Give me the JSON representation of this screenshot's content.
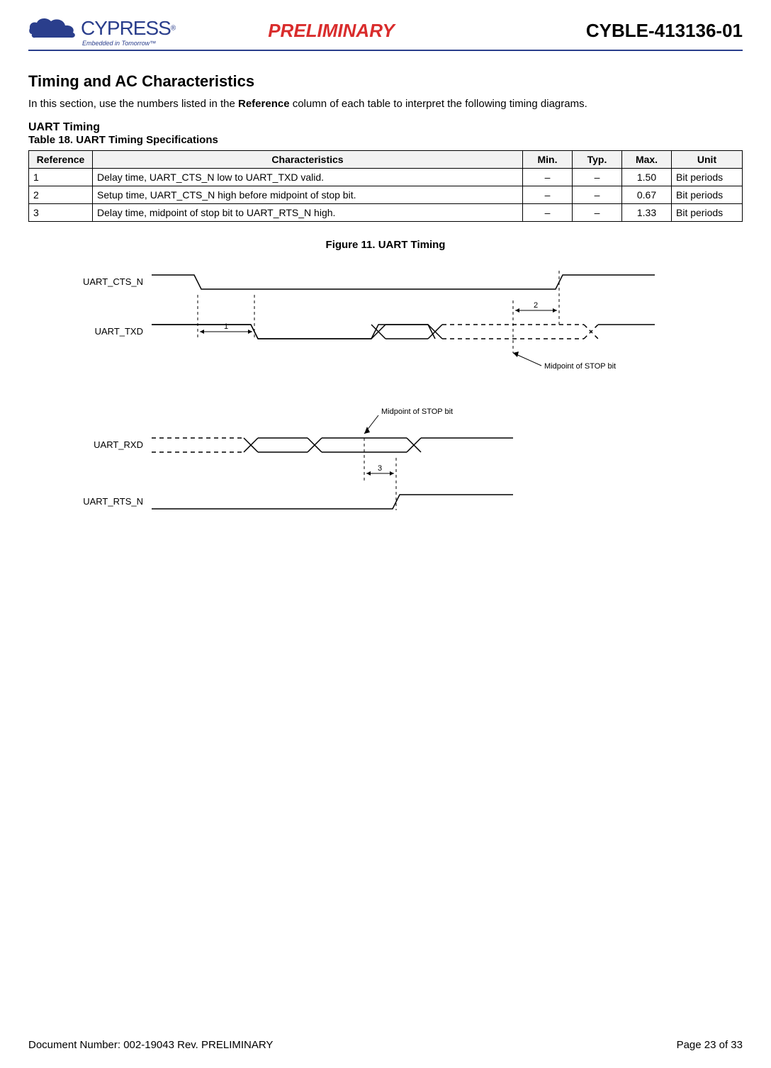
{
  "header": {
    "logo_name": "CYPRESS",
    "logo_tagline": "Embedded in Tomorrow™",
    "center": "PRELIMINARY",
    "right": "CYBLE-413136-01"
  },
  "section_title": "Timing and AC Characteristics",
  "intro_prefix": "In this section, use the numbers listed in the ",
  "intro_bold": "Reference",
  "intro_suffix": " column of each table to interpret the following timing diagrams.",
  "subsection_title": "UART Timing",
  "table_caption": "Table 18.  UART Timing Specifications",
  "table": {
    "headers": {
      "ref": "Reference",
      "char": "Characteristics",
      "min": "Min.",
      "typ": "Typ.",
      "max": "Max.",
      "unit": "Unit"
    },
    "rows": [
      {
        "ref": "1",
        "char": "Delay time, UART_CTS_N low to UART_TXD valid.",
        "min": "–",
        "typ": "–",
        "max": "1.50",
        "unit": "Bit periods"
      },
      {
        "ref": "2",
        "char": "Setup time, UART_CTS_N high before midpoint of stop bit.",
        "min": "–",
        "typ": "–",
        "max": "0.67",
        "unit": "Bit periods"
      },
      {
        "ref": "3",
        "char": "Delay time, midpoint of stop bit to UART_RTS_N high.",
        "min": "–",
        "typ": "–",
        "max": "1.33",
        "unit": "Bit periods"
      }
    ]
  },
  "figure_caption": "Figure 11.  UART Timing",
  "diagram": {
    "signals": {
      "cts": "UART_CTS_N",
      "txd": "UART_TXD",
      "rxd": "UART_RXD",
      "rts": "UART_RTS_N"
    },
    "labels": {
      "m1": "1",
      "m2": "2",
      "m3": "3",
      "midpoint": "Midpoint of STOP bit"
    }
  },
  "footer": {
    "left": "Document Number:  002-19043 Rev. PRELIMINARY",
    "right": "Page 23 of 33"
  }
}
